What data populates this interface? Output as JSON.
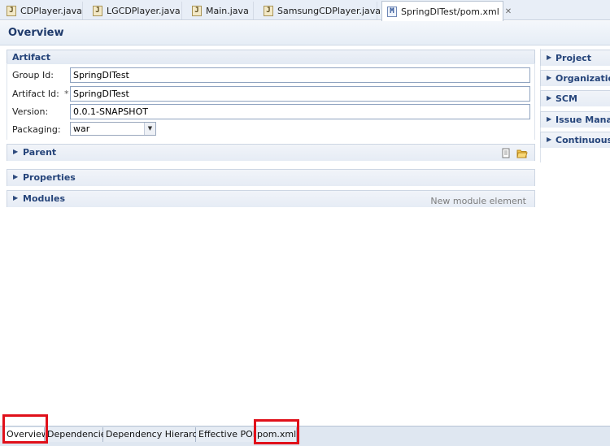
{
  "tabs": [
    {
      "label": "CDPlayer.java",
      "icon": "J"
    },
    {
      "label": "LGCDPlayer.java",
      "icon": "J"
    },
    {
      "label": "Main.java",
      "icon": "J"
    },
    {
      "label": "SamsungCDPlayer.java",
      "icon": "J"
    },
    {
      "label": "SpringDITest/pom.xml",
      "icon": "M",
      "close": "✕"
    }
  ],
  "header": {
    "title": "Overview"
  },
  "artifact": {
    "title": "Artifact",
    "group_id_label": "Group Id:",
    "group_id": "SpringDITest",
    "artifact_id_label": "Artifact Id:",
    "required_marker": "*",
    "artifact_id": "SpringDITest",
    "version_label": "Version:",
    "version": "0.0.1-SNAPSHOT",
    "packaging_label": "Packaging:",
    "packaging": "war"
  },
  "sections": {
    "parent": "Parent",
    "properties": "Properties",
    "modules": "Modules",
    "modules_hint": "New module element"
  },
  "right_sections": [
    "Project",
    "Organization",
    "SCM",
    "Issue Management",
    "Continuous Integration"
  ],
  "bottom_tabs": [
    "Overview",
    "Dependencies",
    "Dependency Hierarchy",
    "Effective POM",
    "pom.xml"
  ],
  "colors": {
    "highlight": "#e0101a",
    "section_title": "#25447a"
  }
}
